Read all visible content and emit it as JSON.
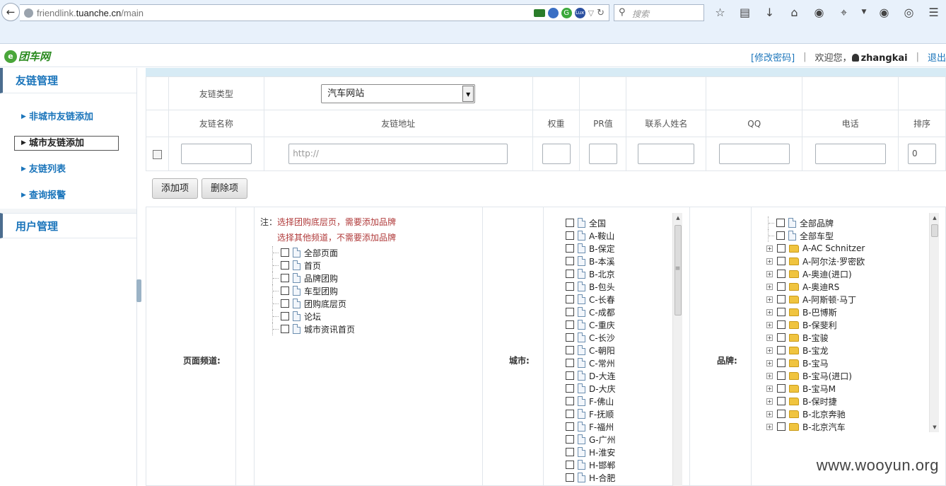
{
  "browser": {
    "url_prefix": "friendlink.",
    "url_domain": "tuanche.cn",
    "url_path": "/main",
    "search_placeholder": "搜索"
  },
  "header": {
    "logo_text": "团车网",
    "change_password": "[修改密码]",
    "welcome": "欢迎您，",
    "username": "zhangkai",
    "logout": "退出",
    "separator": "|"
  },
  "sidebar": {
    "group1_title": "友链管理",
    "items": [
      {
        "label": "非城市友链添加"
      },
      {
        "label": "城市友链添加"
      },
      {
        "label": "友链列表"
      },
      {
        "label": "查询报警"
      }
    ],
    "group2_title": "用户管理"
  },
  "form": {
    "type_label": "友链类型",
    "type_value": "汽车网站",
    "columns": [
      "友链名称",
      "友链地址",
      "权重",
      "PR值",
      "联系人姓名",
      "QQ",
      "电话",
      "排序"
    ],
    "url_placeholder": "http://",
    "sort_default": "0"
  },
  "buttons": {
    "add": "添加项",
    "delete": "删除项"
  },
  "channel": {
    "label": "页面频道:",
    "note_prefix": "注：",
    "note_line1": "选择团购底层页，需要添加品牌",
    "note_line2": "选择其他频道，不需要添加品牌",
    "items": [
      "全部页面",
      "首页",
      "品牌团购",
      "车型团购",
      "团购底层页",
      "论坛",
      "城市资讯首页"
    ]
  },
  "city": {
    "label": "城市:",
    "items": [
      "全国",
      "A-鞍山",
      "B-保定",
      "B-本溪",
      "B-北京",
      "B-包头",
      "C-长春",
      "C-成都",
      "C-重庆",
      "C-长沙",
      "C-朝阳",
      "C-常州",
      "D-大连",
      "D-大庆",
      "F-佛山",
      "F-抚顺",
      "F-福州",
      "G-广州",
      "H-淮安",
      "H-邯郸",
      "H-合肥"
    ]
  },
  "brand": {
    "label": "品牌:",
    "top_items": [
      "全部品牌",
      "全部车型"
    ],
    "items": [
      "A-AC Schnitzer",
      "A-阿尔法·罗密欧",
      "A-奥迪(进口)",
      "A-奥迪RS",
      "A-阿斯顿·马丁",
      "B-巴博斯",
      "B-保斐利",
      "B-宝骏",
      "B-宝龙",
      "B-宝马",
      "B-宝马(进口)",
      "B-宝马M",
      "B-保时捷",
      "B-北京奔驰",
      "B-北京汽车"
    ]
  },
  "watermark": "www.wooyun.org"
}
